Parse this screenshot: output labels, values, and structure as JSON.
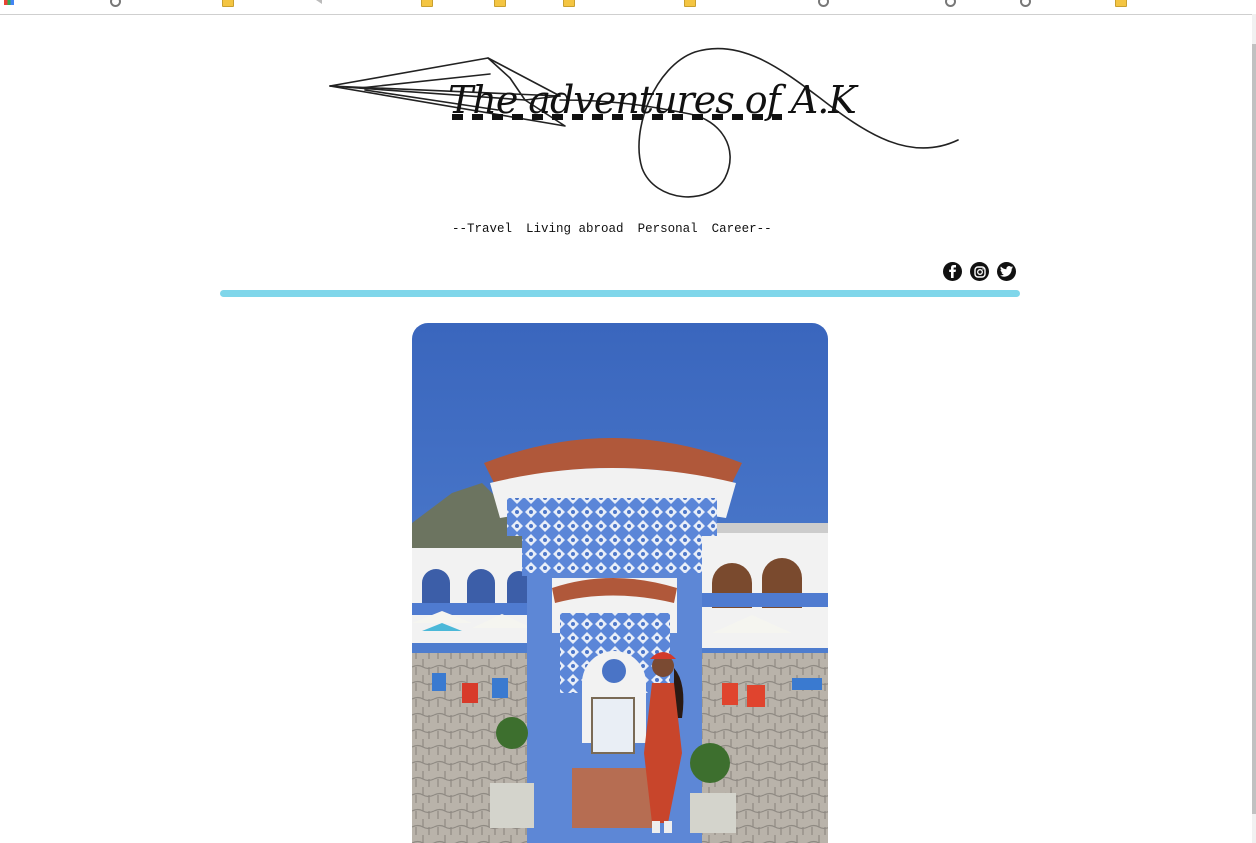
{
  "site": {
    "title": "The adventures of A.K"
  },
  "nav": {
    "prefix": "--",
    "items": [
      "Travel",
      "Living abroad",
      "Personal",
      "Career"
    ],
    "suffix": "--"
  },
  "social": {
    "icons": [
      "facebook-icon",
      "instagram-icon",
      "twitter-icon"
    ]
  },
  "colors": {
    "divider": "#7fd6ea",
    "sky": "#3f6fc4",
    "tower_blue": "#4d7cd6",
    "dress": "#c8452b"
  }
}
